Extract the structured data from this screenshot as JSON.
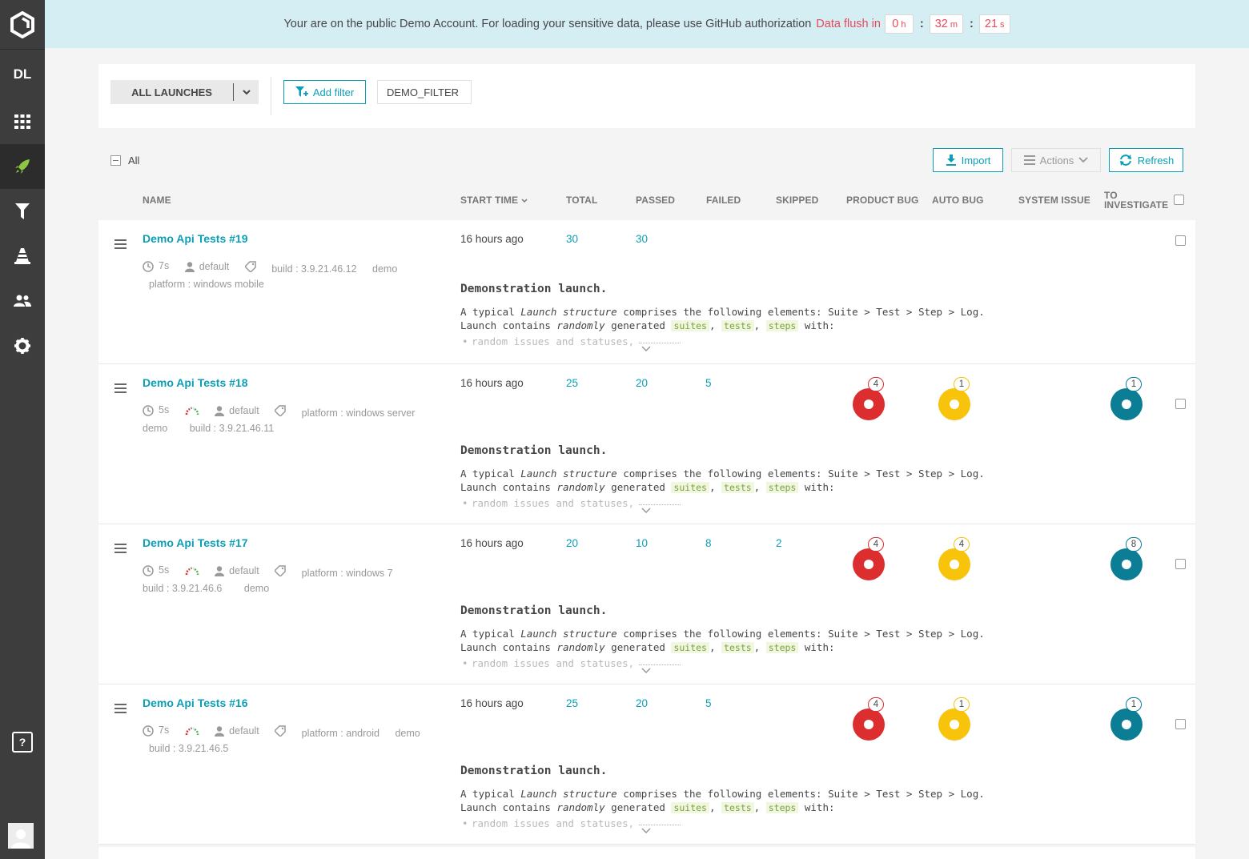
{
  "sidebar": {
    "project_initials": "DL",
    "items": [
      "dashboard",
      "launches",
      "filters",
      "debug",
      "members",
      "settings"
    ],
    "active": "launches",
    "help_label": "?"
  },
  "banner": {
    "message": "Your are on the public Demo Account. For loading your sensitive data, please use GitHub authorization",
    "flush_label": "Data flush in",
    "hours": "0",
    "hours_unit": "h",
    "minutes": "32",
    "minutes_unit": "m",
    "seconds": "21",
    "seconds_unit": "s"
  },
  "filters": {
    "all_launches_label": "ALL LAUNCHES",
    "add_filter_label": "Add filter",
    "demo_filter_label": "DEMO_FILTER"
  },
  "toolbar": {
    "all_label": "All",
    "import_label": "Import",
    "actions_label": "Actions",
    "refresh_label": "Refresh"
  },
  "columns": {
    "name": "NAME",
    "start_time": "START TIME",
    "total": "TOTAL",
    "passed": "PASSED",
    "failed": "FAILED",
    "skipped": "SKIPPED",
    "product_bug": "PRODUCT BUG",
    "auto_bug": "AUTO BUG",
    "system_issue": "SYSTEM ISSUE",
    "to_investigate_1": "TO",
    "to_investigate_2": "INVESTIGATE"
  },
  "description": {
    "title": "Demonstration launch.",
    "line1_a": "A typical ",
    "line1_em": "Launch structure",
    "line1_b": " comprises the following elements: Suite > Test > Step > Log.",
    "line2_a": "Launch contains ",
    "line2_em": "randomly",
    "line2_b": " generated ",
    "tag1": "suites",
    "tag2": "tests",
    "tag3": "steps",
    "comma": ",",
    "line2_c": " with:",
    "bullet": "random issues and statuses,"
  },
  "launches": [
    {
      "name": "Demo Api Tests #19",
      "duration": "7s",
      "owner": "default",
      "attr1": "build : 3.9.21.46.12",
      "attr2": "demo",
      "attr3": "platform : windows mobile",
      "start_time": "16 hours ago",
      "total": "30",
      "passed": "30",
      "failed": "",
      "skipped": "",
      "product_bug": "",
      "auto_bug": "",
      "to_investigate": ""
    },
    {
      "name": "Demo Api Tests #18",
      "duration": "5s",
      "owner": "default",
      "attr1": "platform : windows server",
      "attr2": "demo",
      "attr3": "build : 3.9.21.46.11",
      "start_time": "16 hours ago",
      "total": "25",
      "passed": "20",
      "failed": "5",
      "skipped": "",
      "product_bug": "4",
      "auto_bug": "1",
      "to_investigate": "1"
    },
    {
      "name": "Demo Api Tests #17",
      "duration": "5s",
      "owner": "default",
      "attr1": "platform : windows 7",
      "attr2": "build : 3.9.21.46.6",
      "attr3": "demo",
      "start_time": "16 hours ago",
      "total": "20",
      "passed": "10",
      "failed": "8",
      "skipped": "2",
      "product_bug": "4",
      "auto_bug": "4",
      "to_investigate": "8"
    },
    {
      "name": "Demo Api Tests #16",
      "duration": "7s",
      "owner": "default",
      "attr1": "platform : android",
      "attr2": "demo",
      "attr3": "build : 3.9.21.46.5",
      "start_time": "16 hours ago",
      "total": "25",
      "passed": "20",
      "failed": "5",
      "skipped": "",
      "product_bug": "4",
      "auto_bug": "1",
      "to_investigate": "1"
    }
  ],
  "colors": {
    "accent": "#0b9fb7",
    "product_bug": "#dc2e2e",
    "auto_bug": "#f7c30b",
    "to_investigate": "#0b7e95",
    "flush_red": "#e8495c"
  }
}
